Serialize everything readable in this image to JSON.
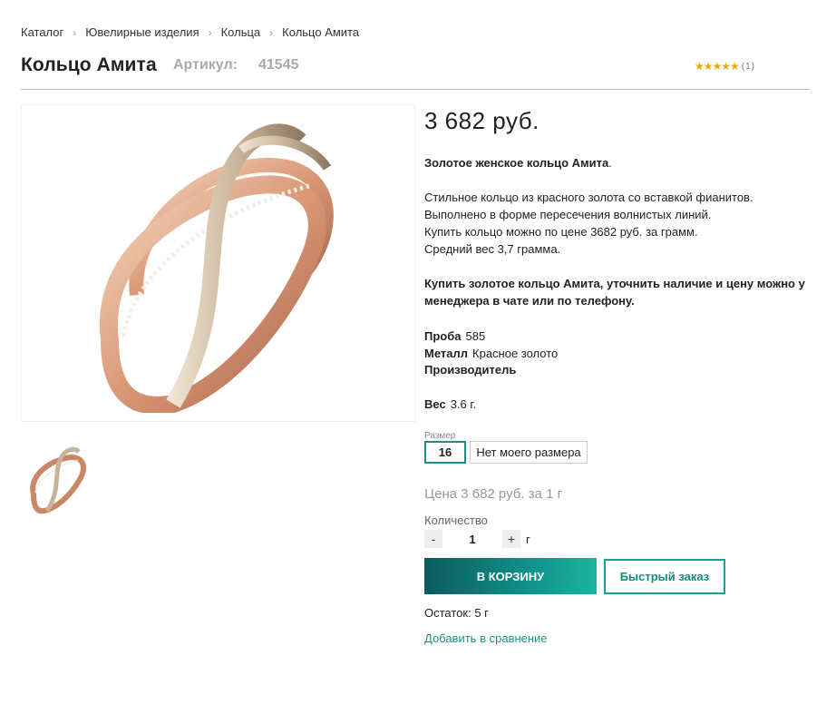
{
  "breadcrumb": [
    "Каталог",
    "Ювелирные изделия",
    "Кольца",
    "Кольцо Амита"
  ],
  "breadcrumb_sep": "›",
  "product": {
    "title": "Кольцо Амита",
    "sku_label": "Артикул:",
    "sku": "41545",
    "rating": {
      "stars": "★★★★★",
      "count": "(1)"
    },
    "price": "3 682 руб.",
    "intro_bold": "Золотое женское кольцо Амита",
    "intro_tail": ".",
    "description": [
      "Стильное кольцо из красного золота со вставкой фианитов.",
      "Выполнено в форме пересечения волнистых линий.",
      "Купить кольцо можно по цене 3682 руб. за грамм.",
      "Средний вес 3,7 грамма."
    ],
    "buy_note": "Купить золотое кольцо Амита, уточнить наличие и цену можно у менеджера в чате или по телефону.",
    "props": {
      "probe_label": "Проба",
      "probe_value": "585",
      "metal_label": "Металл",
      "metal_value": "Красное золото",
      "maker_label": "Производитель",
      "maker_value": ""
    },
    "weight_label": "Вес",
    "weight_value": "3.6 г."
  },
  "size": {
    "label": "Размер",
    "options": [
      "16",
      "Нет моего размера"
    ],
    "selected": "16"
  },
  "price_per": "Цена 3 682 руб. за 1 г",
  "quantity": {
    "label": "Количество",
    "minus": "-",
    "value": "1",
    "plus": "+",
    "unit": "г"
  },
  "buttons": {
    "cart": "В КОРЗИНУ",
    "quick": "Быстрый заказ"
  },
  "stock": "Остаток: 5 г",
  "compare": "Добавить в сравнение",
  "colors": {
    "accent": "#1a9f92",
    "cart_start": "#0d5a5e",
    "cart_end": "#1ab39e",
    "star": "#f0a80a"
  }
}
